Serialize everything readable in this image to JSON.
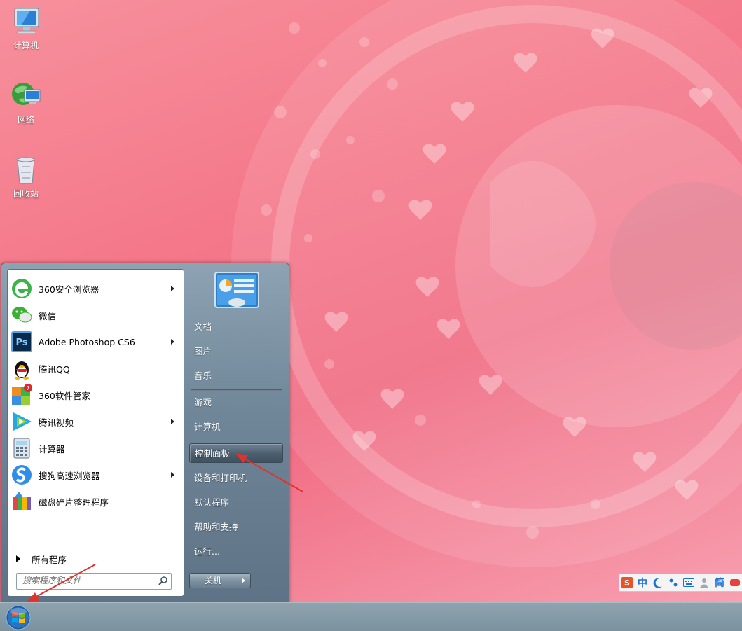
{
  "desktop": {
    "icons": [
      {
        "label": "计算机",
        "icon": "computer-icon"
      },
      {
        "label": "网络",
        "icon": "network-icon"
      },
      {
        "label": "回收站",
        "icon": "recycle-bin-icon"
      }
    ]
  },
  "start_menu": {
    "programs": [
      {
        "label": "360安全浏览器",
        "icon": "360-browser-icon",
        "submenu": true
      },
      {
        "label": "微信",
        "icon": "wechat-icon",
        "submenu": false
      },
      {
        "label": "Adobe Photoshop CS6",
        "icon": "photoshop-icon",
        "submenu": true
      },
      {
        "label": "腾讯QQ",
        "icon": "qq-penguin-icon",
        "submenu": false
      },
      {
        "label": "360软件管家",
        "icon": "360-software-manager-icon",
        "submenu": false
      },
      {
        "label": "腾讯视频",
        "icon": "tencent-video-icon",
        "submenu": true
      },
      {
        "label": "计算器",
        "icon": "calculator-icon",
        "submenu": false
      },
      {
        "label": "搜狗高速浏览器",
        "icon": "sogou-browser-icon",
        "submenu": true
      },
      {
        "label": "磁盘碎片整理程序",
        "icon": "disk-defragmenter-icon",
        "submenu": false
      }
    ],
    "all_programs_label": "所有程序",
    "search_placeholder": "搜索程序和文件",
    "right_items": [
      {
        "label": "文档"
      },
      {
        "label": "图片"
      },
      {
        "label": "音乐"
      },
      {
        "label": "游戏"
      },
      {
        "label": "计算机"
      },
      {
        "label": "控制面板",
        "highlighted": true
      },
      {
        "label": "设备和打印机"
      },
      {
        "label": "默认程序"
      },
      {
        "label": "帮助和支持"
      },
      {
        "label": "运行..."
      }
    ],
    "shutdown_label": "关机"
  },
  "ime_toolbar": {
    "mode_label": "中",
    "simplified_label": "简",
    "icons": [
      "sogou-logo-icon",
      "moon-icon",
      "punctuation-icon",
      "keyboard-icon",
      "user-icon",
      "skin-icon"
    ]
  },
  "colors": {
    "annotation_arrow": "#e0312b",
    "highlight": "#4b5e6e",
    "taskbar": "#7b929e"
  }
}
